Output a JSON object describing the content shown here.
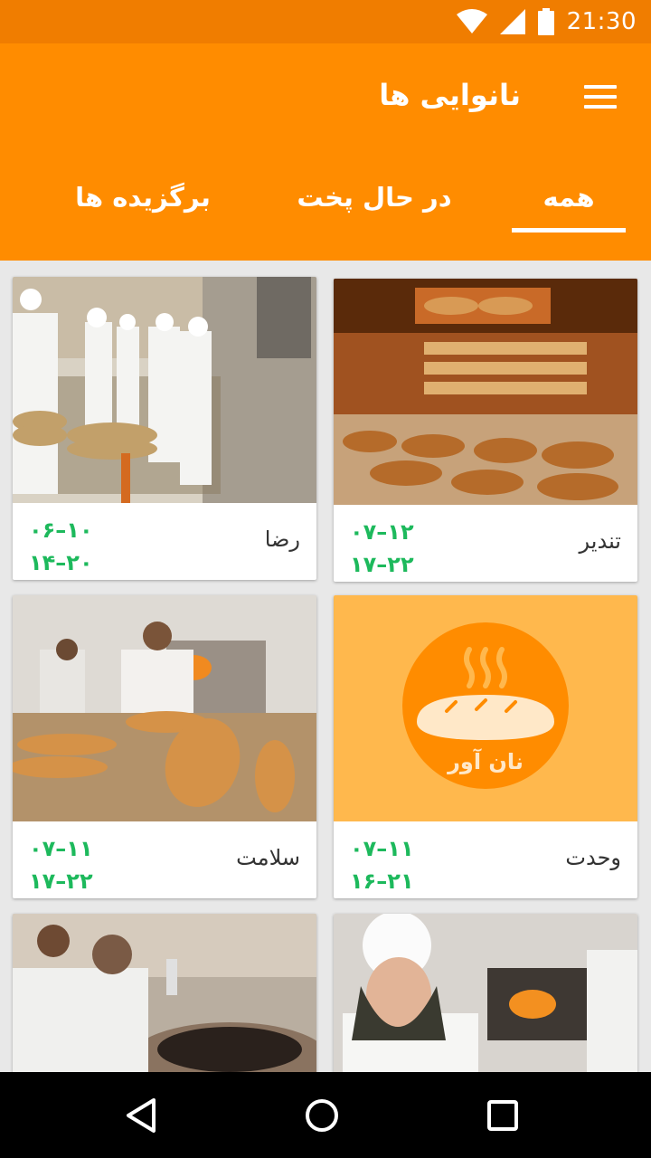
{
  "status_bar": {
    "time": "21:30",
    "icons": [
      "wifi-icon",
      "cell-signal-icon",
      "battery-icon"
    ]
  },
  "app_bar": {
    "title": "نانوایی ها",
    "menu_icon": "hamburger-menu-icon",
    "color": "#ff8c00",
    "status_color": "#f07d00"
  },
  "tabs": [
    {
      "label": "همه",
      "selected": true
    },
    {
      "label": "در حال پخت",
      "selected": false
    },
    {
      "label": "برگزیده ها",
      "selected": false
    }
  ],
  "bakeries": [
    {
      "name": "رضا",
      "hours_1": "۰۶–۱۰",
      "hours_2": "۱۴–۲۰",
      "image": "bakers-flatbread-photo"
    },
    {
      "name": "تندیر",
      "hours_1": "۰۷–۱۲",
      "hours_2": "۱۷–۲۲",
      "image": "bakery-display-photo"
    },
    {
      "name": "سلامت",
      "hours_1": "۰۷–۱۱",
      "hours_2": "۱۷–۲۲",
      "image": "baker-oven-photo"
    },
    {
      "name": "وحدت",
      "hours_1": "۰۷–۱۱",
      "hours_2": "۱۶–۲۱",
      "image": "bread-logo-placeholder",
      "logo_text": "نان آور"
    },
    {
      "name": "",
      "hours_1": "",
      "hours_2": "",
      "image": "tandoor-bakers-photo"
    },
    {
      "name": "",
      "hours_1": "",
      "hours_2": "",
      "image": "woman-baker-photo"
    }
  ],
  "colors": {
    "accent": "#ff8c00",
    "hours_text": "#1db95c",
    "placeholder_bg": "#ffb84d",
    "logo_circle": "#ff8c00"
  },
  "nav_bar": {
    "buttons": [
      "back-icon",
      "home-icon",
      "recents-icon"
    ]
  }
}
